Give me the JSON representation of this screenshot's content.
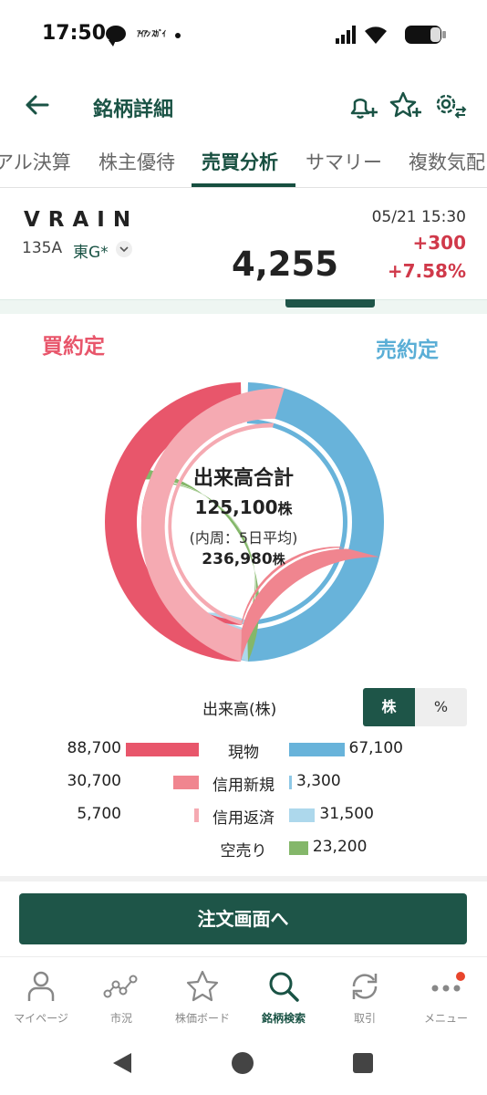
{
  "status": {
    "time": "17:50",
    "mini_app_text": "ｱｲｱﾝ ｽｶﾞｲ"
  },
  "appbar": {
    "title": "銘柄詳細"
  },
  "tabs": [
    {
      "label": "アル決算"
    },
    {
      "label": "株主優待"
    },
    {
      "label": "売買分析",
      "active": true
    },
    {
      "label": "サマリー"
    },
    {
      "label": "複数気配"
    }
  ],
  "stock": {
    "name": "VRAIN",
    "code": "135A",
    "market": "東G*",
    "price": "4,255",
    "datetime": "05/21 15:30",
    "change": "+300",
    "change_pct": "+7.58%"
  },
  "analysis": {
    "buy_label": "買約定",
    "sell_label": "売約定",
    "center_title": "出来高合計",
    "total_volume": "125,100",
    "unit": "株",
    "avg_label": "(内周：5日平均)",
    "avg_volume": "236,980"
  },
  "volume_table": {
    "caption": "出来高(株)",
    "toggle_stock": "株",
    "toggle_pct": "%",
    "rows": [
      {
        "label": "現物",
        "left": "88,700",
        "right": "67,100"
      },
      {
        "label": "信用新規",
        "left": "30,700",
        "right": "3,300"
      },
      {
        "label": "信用返済",
        "left": "5,700",
        "right": "31,500"
      },
      {
        "label": "空売り",
        "left": "",
        "right": "23,200"
      }
    ]
  },
  "chart_data": {
    "type": "pie",
    "title": "出来高合計",
    "total": 125100,
    "series": [
      {
        "name": "買約定",
        "categories": [
          "現物",
          "信用新規",
          "信用返済"
        ],
        "values": [
          88700,
          30700,
          5700
        ]
      },
      {
        "name": "売約定",
        "categories": [
          "現物",
          "信用新規",
          "信用返済",
          "空売り"
        ],
        "values": [
          67100,
          3300,
          31500,
          23200
        ]
      }
    ],
    "colors": {
      "buy_cash": "#e8566b",
      "buy_margin_new": "#f0858f",
      "buy_margin_close": "#f5aab2",
      "sell_cash": "#68b3da",
      "sell_margin_new": "#8ec8e6",
      "sell_margin_close": "#add8ec",
      "short_sell": "#84b76a"
    }
  },
  "order_button": {
    "label": "注文画面へ"
  },
  "bottom_nav": [
    {
      "label": "マイページ",
      "icon": "person-icon"
    },
    {
      "label": "市況",
      "icon": "market-icon"
    },
    {
      "label": "株価ボード",
      "icon": "star-icon"
    },
    {
      "label": "銘柄検索",
      "icon": "search-icon",
      "active": true
    },
    {
      "label": "取引",
      "icon": "refresh-icon"
    },
    {
      "label": "メニュー",
      "icon": "more-icon",
      "badge": true
    }
  ]
}
